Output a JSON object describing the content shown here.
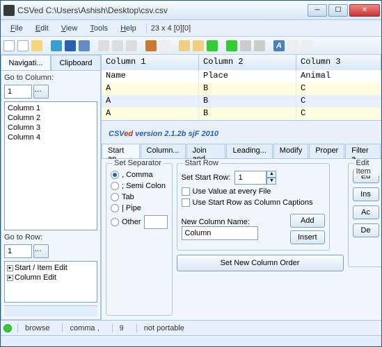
{
  "window": {
    "title": "CSVed C:\\Users\\Ashish\\Desktop\\csv.csv"
  },
  "menu": {
    "file": "File",
    "edit": "Edit",
    "view": "View",
    "tools": "Tools",
    "help": "Help",
    "info": "23 x 4 [0][0]"
  },
  "left": {
    "tab_nav": "Navigati...",
    "tab_clip": "Clipboard",
    "goto_col_label": "Go to Column:",
    "goto_col_value": "1",
    "columns": [
      "Column 1",
      "Column 2",
      "Column 3",
      "Column 4"
    ],
    "goto_row_label": "Go to Row:",
    "goto_row_value": "1",
    "tree": [
      "Start / Item Edit",
      "Column Edit"
    ]
  },
  "grid": {
    "cols": [
      "Column 1",
      "Column 2",
      "Column 3"
    ],
    "header_row": [
      "Name",
      "Place",
      "Animal"
    ],
    "rows": [
      [
        "A",
        "B",
        "C"
      ],
      [
        "A",
        "B",
        "C"
      ],
      [
        "A",
        "B",
        "C"
      ]
    ]
  },
  "brand": {
    "csv": "CSV",
    "ed": "ed",
    "rest": " version 2.1.2b sjF 2010"
  },
  "tabs": [
    "Start an...",
    "Column...",
    "Join and...",
    "Leading...",
    "Modify",
    "Proper",
    "Filter a..."
  ],
  "separator": {
    "legend": "Set Separator",
    "comma": ", Comma",
    "semi": "; Semi Colon",
    "tab": "Tab",
    "pipe": "| Pipe",
    "other": "Other"
  },
  "startrow": {
    "legend": "Start Row",
    "set_label": "Set Start Row:",
    "set_value": "1",
    "use_value": "Use Value at every File",
    "use_caption": "Use Start Row as Column Captions",
    "newcol_label": "New Column Name:",
    "newcol_value": "Column",
    "add": "Add",
    "insert": "Insert"
  },
  "edit_group": {
    "legend": "Edit Item",
    "ed": "Ed",
    "ins": "Ins",
    "ac": "Ac",
    "de": "De"
  },
  "set_order": "Set New Column Order",
  "status": {
    "browse": "browse",
    "comma": "comma ,",
    "count": "9",
    "portable": "not portable"
  }
}
